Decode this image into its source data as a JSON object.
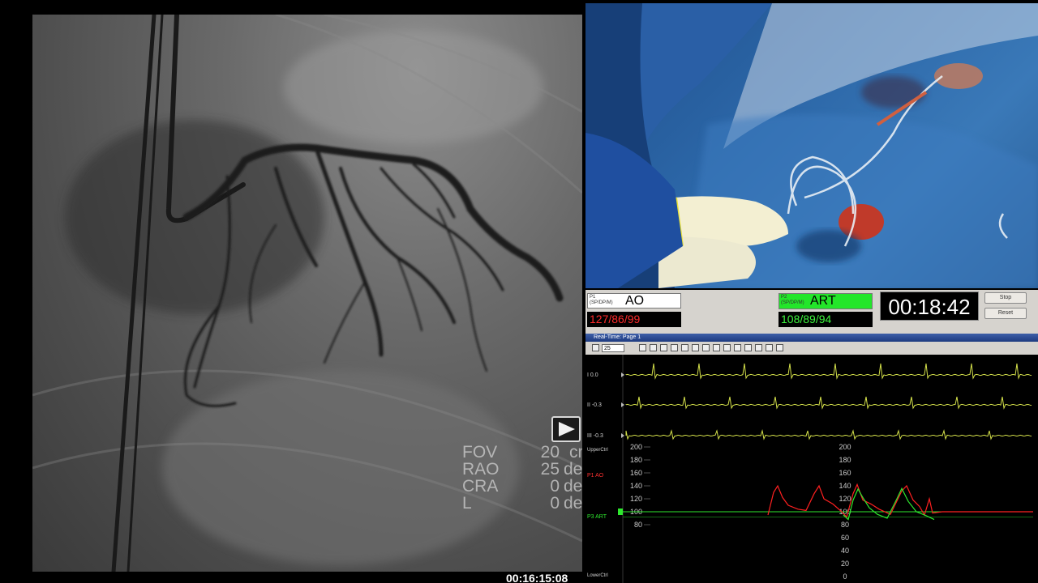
{
  "angio": {
    "overlay": [
      {
        "key": "FOV",
        "value": "20",
        "unit": "cm"
      },
      {
        "key": "RAO",
        "value": "25",
        "unit": "deg"
      },
      {
        "key": "CRA",
        "value": "0",
        "unit": "deg"
      },
      {
        "key": "L",
        "value": "0",
        "unit": "deg"
      }
    ],
    "timestamp": "00:16:15:08"
  },
  "monitor": {
    "p1": {
      "tag": "P1",
      "tag_sub": "(SP/DP/M)",
      "name": "AO",
      "values": "127/86/99"
    },
    "p2": {
      "tag": "P2",
      "tag_sub": "(SP/DP/M)",
      "name": "ART",
      "values": "108/89/94"
    },
    "timer": "00:18:42",
    "buttons": {
      "stop": "Stop",
      "reset": "Reset"
    },
    "realtime_title": "Real-Time: Page 1",
    "zoom_value": "25",
    "channels": [
      {
        "label": "I 0.0"
      },
      {
        "label": "II -0.3"
      },
      {
        "label": "III -0.3"
      },
      {
        "label": "UpperCtrl"
      },
      {
        "label": "P1 AO"
      },
      {
        "label": "P3 ART"
      },
      {
        "label": "LowerCtrl"
      }
    ],
    "scale_left": [
      "200",
      "180",
      "160",
      "140",
      "120",
      "100",
      "80"
    ],
    "scale_mid": [
      "200",
      "180",
      "160",
      "140",
      "120",
      "100",
      "80",
      "60",
      "40",
      "20",
      "0"
    ],
    "colors": {
      "ecg": "#d4e04a",
      "ao": "#ff2020",
      "art": "#2ee82e"
    }
  }
}
